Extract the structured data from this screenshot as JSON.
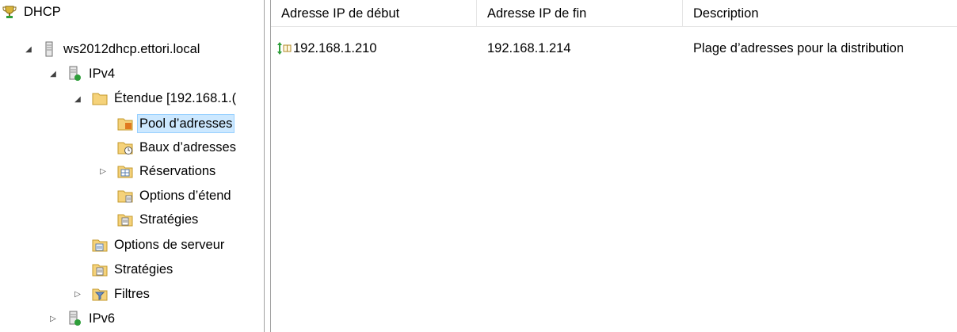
{
  "tree": {
    "root": {
      "label": "DHCP",
      "icon": "dhcp-trophy-icon"
    },
    "server": {
      "label": "ws2012dhcp.ettori.local",
      "icon": "server-icon"
    },
    "ipv4": {
      "label": "IPv4",
      "icon": "ipv4-icon"
    },
    "scope": {
      "label": "Étendue [192.168.1.(",
      "icon": "folder-icon"
    },
    "pool": {
      "label": "Pool d’adresses",
      "icon": "address-pool-icon"
    },
    "leases": {
      "label": "Baux d’adresses",
      "icon": "address-leases-icon"
    },
    "reservations": {
      "label": "Réservations",
      "icon": "reservations-icon"
    },
    "scope_options": {
      "label": "Options d’étend",
      "icon": "scope-options-icon"
    },
    "scope_policies": {
      "label": "Stratégies",
      "icon": "policies-icon"
    },
    "server_options": {
      "label": "Options de serveur",
      "icon": "server-options-icon"
    },
    "server_policies": {
      "label": "Stratégies",
      "icon": "policies-icon"
    },
    "filters": {
      "label": "Filtres",
      "icon": "filter-icon"
    },
    "ipv6": {
      "label": "IPv6",
      "icon": "ipv6-icon"
    }
  },
  "list": {
    "columns": [
      "Adresse IP de début",
      "Adresse IP de fin",
      "Description"
    ],
    "rows": [
      {
        "icon": "address-range-icon",
        "start": "192.168.1.210",
        "end": "192.168.1.214",
        "description": "Plage d’adresses pour la distribution"
      }
    ]
  },
  "colors": {
    "selection": "#cce8ff",
    "selection_border": "#99d1ff",
    "folder": "#f5d27a",
    "green": "#2e9e3a"
  }
}
